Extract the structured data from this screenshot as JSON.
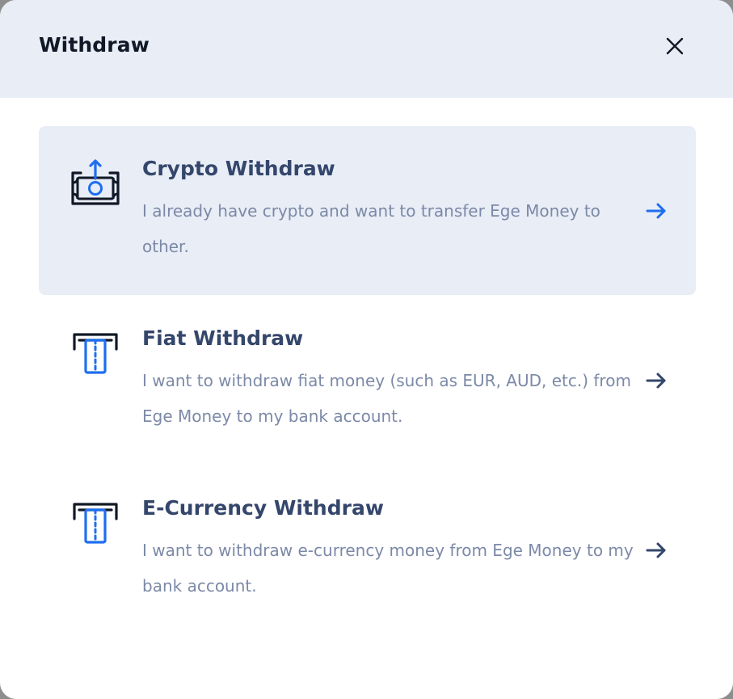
{
  "modal": {
    "title": "Withdraw",
    "close_icon": "close-icon"
  },
  "options": [
    {
      "title": "Crypto Withdraw",
      "description": "I already have crypto and want to transfer Ege Money to other.",
      "icon": "cash-upload-icon",
      "active": true,
      "arrow_color": "#1e6ef0"
    },
    {
      "title": "Fiat Withdraw",
      "description": "I want to withdraw fiat money (such as EUR, AUD, etc.) from Ege Money to my bank account.",
      "icon": "atm-card-icon",
      "active": false,
      "arrow_color": "#34466b"
    },
    {
      "title": "E-Currency Withdraw",
      "description": "I want to withdraw e-currency money from Ege Money to my bank account.",
      "icon": "atm-card-icon",
      "active": false,
      "arrow_color": "#34466b"
    }
  ],
  "colors": {
    "header_bg": "#e8edf6",
    "accent_blue": "#1e6ef0",
    "title_text": "#34466b",
    "desc_text": "#7c89a7"
  }
}
